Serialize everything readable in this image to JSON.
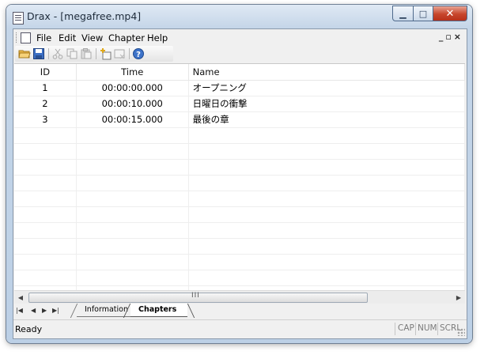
{
  "window": {
    "title": "Drax - [megafree.mp4]"
  },
  "menu": {
    "items": [
      "File",
      "Edit",
      "View",
      "Chapter",
      "Help"
    ],
    "mdi_controls": "_ & ×"
  },
  "toolbar": {
    "icons": [
      "open-folder-icon",
      "save-icon",
      "cut-icon",
      "copy-icon",
      "paste-icon",
      "add-chapter-icon",
      "remove-chapter-icon",
      "help-icon"
    ]
  },
  "table": {
    "columns": [
      "ID",
      "Time",
      "Name"
    ],
    "rows": [
      {
        "id": "1",
        "time": "00:00:00.000",
        "name": "オープニング"
      },
      {
        "id": "2",
        "time": "00:00:10.000",
        "name": "日曜日の衝撃"
      },
      {
        "id": "3",
        "time": "00:00:15.000",
        "name": "最後の章"
      }
    ]
  },
  "scrollbar": {
    "grip": "III"
  },
  "tabs": {
    "information": "Information",
    "chapters": "Chapters",
    "active": "Chapters"
  },
  "status": {
    "text": "Ready",
    "cap": "CAP",
    "num": "NUM",
    "scrl": "SCRL"
  }
}
